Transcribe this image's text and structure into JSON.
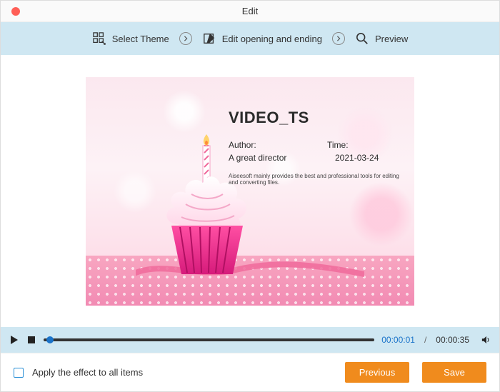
{
  "window": {
    "title": "Edit"
  },
  "steps": {
    "select_theme": "Select Theme",
    "edit_opening": "Edit opening and ending",
    "preview": "Preview"
  },
  "video_overlay": {
    "title": "VIDEO_TS",
    "author_label": "Author:",
    "author_value": "A great director",
    "time_label": "Time:",
    "time_value": "2021-03-24",
    "tagline": "Aiseesoft mainly provides the best and professional tools for editing and converting files."
  },
  "player": {
    "current_time": "00:00:01",
    "separator": "/",
    "total_time": "00:00:35"
  },
  "footer": {
    "checkbox_label": "Apply the effect to all items",
    "previous": "Previous",
    "save": "Save"
  }
}
